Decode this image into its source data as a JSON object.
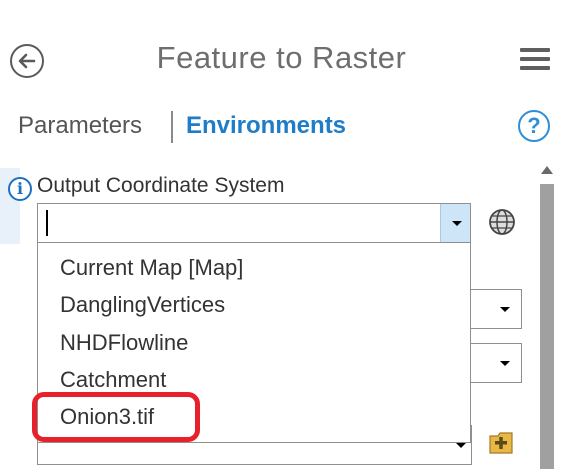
{
  "header": {
    "title": "Feature to Raster",
    "back_icon": "back-arrow-icon",
    "menu_icon": "hamburger-menu-icon"
  },
  "tabs": {
    "parameters_label": "Parameters",
    "environments_label": "Environments",
    "active": "Environments",
    "help_icon": "help-icon",
    "help_glyph": "?"
  },
  "field": {
    "label": "Output Coordinate System",
    "info_glyph": "i",
    "value": "",
    "globe_icon": "globe-icon"
  },
  "dropdown": {
    "items": [
      "Current Map [Map]",
      "DanglingVertices",
      "NHDFlowline",
      "Catchment",
      "Onion3.tif"
    ],
    "highlighted_item": "Onion3.tif"
  },
  "colors": {
    "accent": "#1e7dc8",
    "annotation": "#e8202a",
    "dropdown_arrow_bg": "#cde5f7"
  }
}
